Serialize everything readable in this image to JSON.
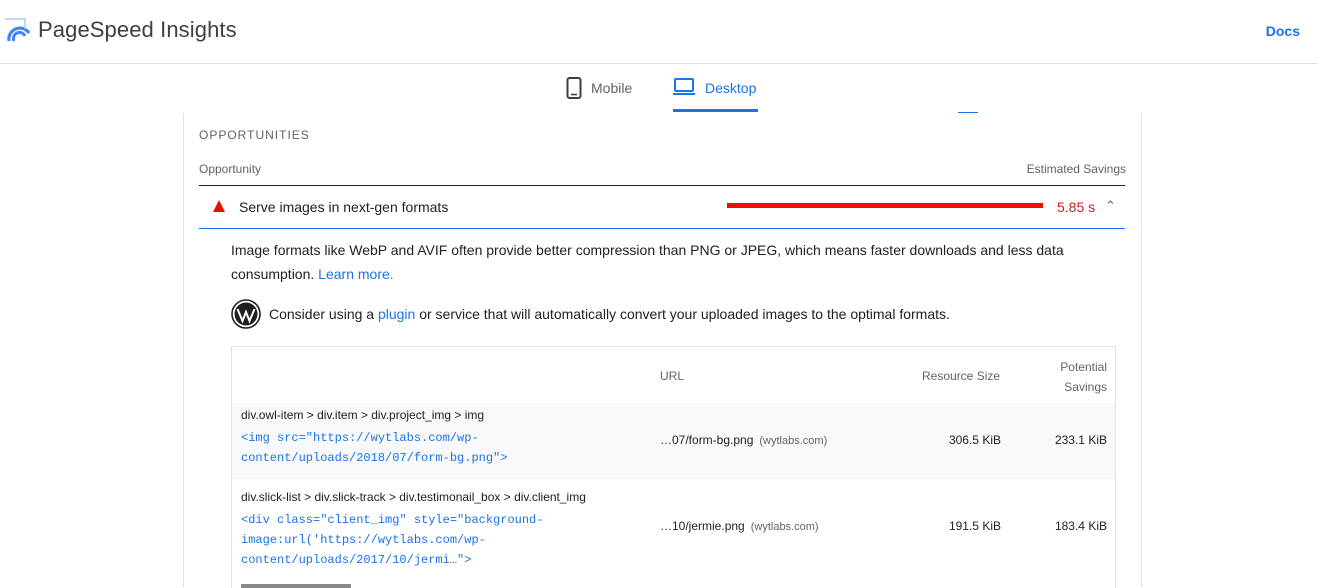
{
  "header": {
    "title": "PageSpeed Insights",
    "docs_label": "Docs"
  },
  "tabs": [
    {
      "label": "Mobile",
      "selected": false
    },
    {
      "label": "Desktop",
      "selected": true
    }
  ],
  "opportunities": {
    "section_title": "OPPORTUNITIES",
    "col_opportunity": "Opportunity",
    "col_savings": "Estimated Savings",
    "audit": {
      "title": "Serve images in next-gen formats",
      "savings": "5.85 s",
      "description": "Image formats like WebP and AVIF often provide better compression than PNG or JPEG, which means faster downloads and less data consumption. ",
      "learn_more": "Learn more.",
      "wp_text_before": "Consider using a ",
      "wp_link": "plugin",
      "wp_text_after": " or service that will automatically convert your uploaded images to the optimal formats."
    },
    "table": {
      "headers": {
        "url": "URL",
        "size": "Resource Size",
        "potential_1": "Potential",
        "potential_2": "Savings"
      },
      "rows": [
        {
          "node_path": "div.owl-item > div.item > div.project_img > img",
          "snippet_1": "<img src=\"https://wytlabs.com/wp-",
          "snippet_2": "content/uploads/2018/07/form-bg.png\">",
          "url": "…07/form-bg.png",
          "host": "(wytlabs.com)",
          "size": "306.5 KiB",
          "savings": "233.1 KiB"
        },
        {
          "node_path": "div.slick-list > div.slick-track > div.testimonail_box > div.client_img",
          "snippet_1": "<div class=\"client_img\" style=\"background-",
          "snippet_2": "image:url('https://wytlabs.com/wp-",
          "snippet_3": "content/uploads/2017/10/jermi…\">",
          "url": "…10/jermie.png",
          "host": "(wytlabs.com)",
          "size": "191.5 KiB",
          "savings": "183.4 KiB"
        }
      ]
    }
  },
  "colors": {
    "accent": "#1a73e8",
    "fail": "#eb0f00",
    "fail_text": "#c5221f"
  }
}
